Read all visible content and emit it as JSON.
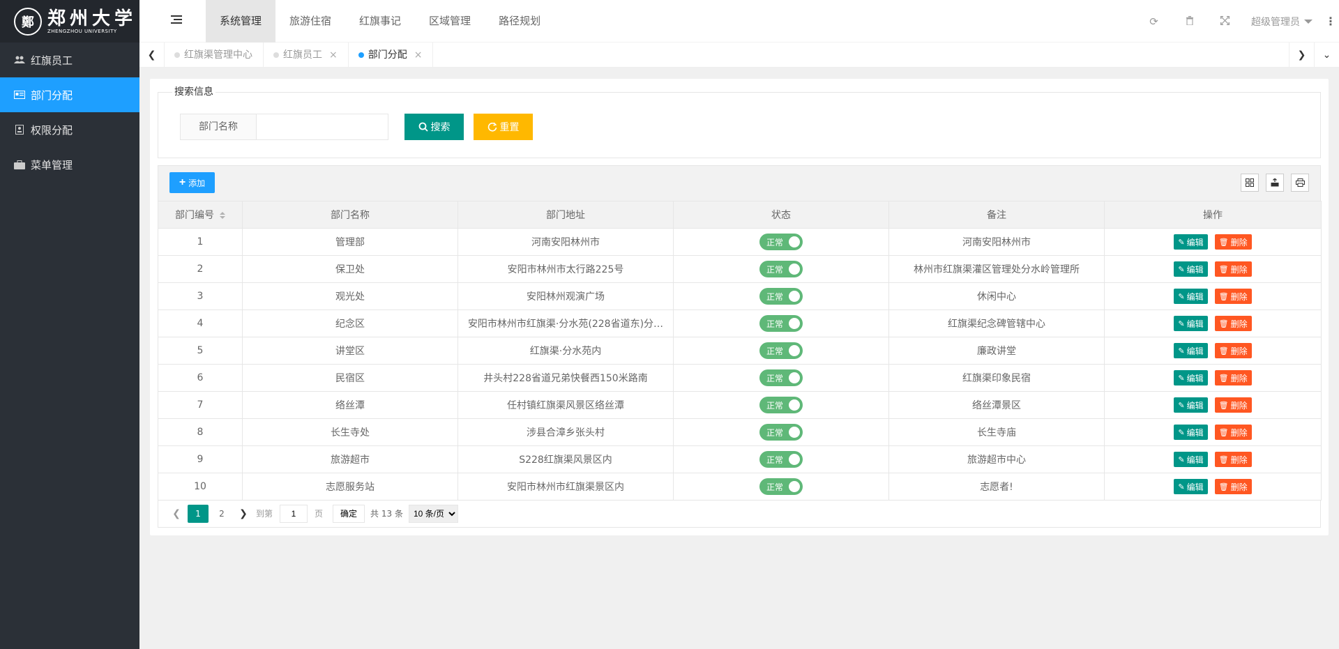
{
  "logo": {
    "seal": "鄭",
    "cn": "郑州大学",
    "en": "ZHENGZHOU UNIVERSITY"
  },
  "sidebar": {
    "items": [
      {
        "label": "红旗员工",
        "icon": "users-icon",
        "active": false
      },
      {
        "label": "部门分配",
        "icon": "id-card-icon",
        "active": true
      },
      {
        "label": "权限分配",
        "icon": "badge-icon",
        "active": false
      },
      {
        "label": "菜单管理",
        "icon": "briefcase-icon",
        "active": false
      }
    ]
  },
  "header": {
    "nav": [
      {
        "label": "系统管理",
        "active": true
      },
      {
        "label": "旅游住宿",
        "active": false
      },
      {
        "label": "红旗事记",
        "active": false
      },
      {
        "label": "区域管理",
        "active": false
      },
      {
        "label": "路径规划",
        "active": false
      }
    ],
    "user": "超级管理员"
  },
  "tabs": [
    {
      "label": "红旗渠管理中心",
      "active": false,
      "closable": false
    },
    {
      "label": "红旗员工",
      "active": false,
      "closable": true
    },
    {
      "label": "部门分配",
      "active": true,
      "closable": true
    }
  ],
  "search": {
    "legend": "搜索信息",
    "label": "部门名称",
    "value": "",
    "search_btn": "搜索",
    "reset_btn": "重置"
  },
  "toolbar": {
    "add_btn": "添加"
  },
  "table": {
    "columns": [
      "部门编号",
      "部门名称",
      "部门地址",
      "状态",
      "备注",
      "操作"
    ],
    "status_label": "正常",
    "edit_label": "编辑",
    "delete_label": "删除",
    "rows": [
      {
        "id": "1",
        "name": "管理部",
        "address": "河南安阳林州市",
        "remark": "河南安阳林州市"
      },
      {
        "id": "2",
        "name": "保卫处",
        "address": "安阳市林州市太行路225号",
        "remark": "林州市红旗渠灌区管理处分水岭管理所"
      },
      {
        "id": "3",
        "name": "观光处",
        "address": "安阳林州观演广场",
        "remark": "休闲中心"
      },
      {
        "id": "4",
        "name": "纪念区",
        "address": "安阳市林州市红旗渠·分水苑(228省道东)分…",
        "remark": "红旗渠纪念碑管辖中心"
      },
      {
        "id": "5",
        "name": "讲堂区",
        "address": "红旗渠·分水苑内",
        "remark": "廉政讲堂"
      },
      {
        "id": "6",
        "name": "民宿区",
        "address": "井头村228省道兄弟快餐西150米路南",
        "remark": "红旗渠印象民宿"
      },
      {
        "id": "7",
        "name": "络丝潭",
        "address": "任村镇红旗渠风景区络丝潭",
        "remark": "络丝潭景区"
      },
      {
        "id": "8",
        "name": "长生寺处",
        "address": "涉县合漳乡张头村",
        "remark": "长生寺庙"
      },
      {
        "id": "9",
        "name": "旅游超市",
        "address": "S228红旗渠风景区内",
        "remark": "旅游超市中心"
      },
      {
        "id": "10",
        "name": "志愿服务站",
        "address": "安阳市林州市红旗渠景区内",
        "remark": "志愿者!"
      }
    ]
  },
  "pager": {
    "pages": [
      "1",
      "2"
    ],
    "current": "1",
    "goto_prefix": "到第",
    "goto_value": "1",
    "goto_suffix": "页",
    "ok": "确定",
    "total": "共 13 条",
    "page_size": "10 条/页"
  }
}
